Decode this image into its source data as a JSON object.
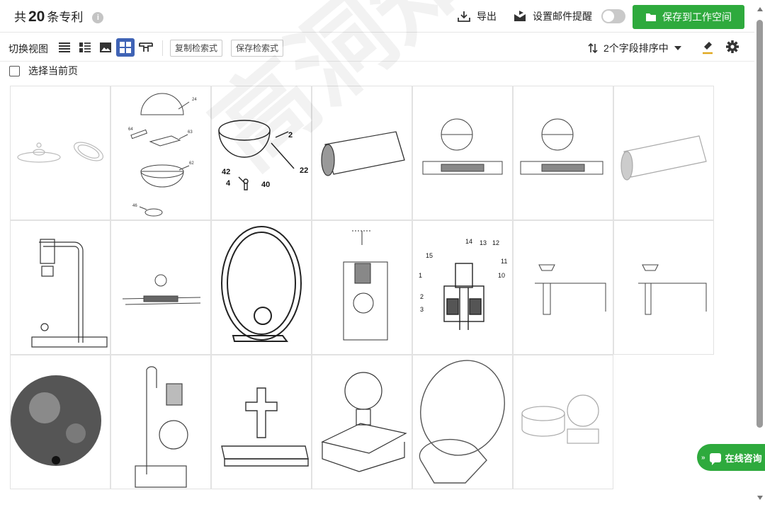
{
  "header": {
    "count_prefix": "共",
    "count": "20",
    "count_suffix": "条专利",
    "info_icon": "i",
    "export_label": "导出",
    "email_alert_label": "设置邮件提醒",
    "email_alert_enabled": false,
    "save_workspace_label": "保存到工作空间",
    "accent_color": "#2eaa3d"
  },
  "toolbar": {
    "view_label": "切换视图",
    "views": [
      "list-view-icon",
      "detail-list-view-icon",
      "image-view-icon",
      "grid-view-icon",
      "pattern-view-icon"
    ],
    "active_view": "grid-view-icon",
    "copy_query_label": "复制检索式",
    "save_query_label": "保存检索式",
    "sort_label": "2个字段排序中"
  },
  "select_page_label": "选择当前页",
  "patents": [
    {
      "figure": "disc-lamp"
    },
    {
      "figure": "exploded-sphere"
    },
    {
      "figure": "bowl-with-pin"
    },
    {
      "figure": "cylinder-texture"
    },
    {
      "figure": "sphere-over-board"
    },
    {
      "figure": "sphere-over-board"
    },
    {
      "figure": "cylinder"
    },
    {
      "figure": "arch-lamp"
    },
    {
      "figure": "small-assembly"
    },
    {
      "figure": "ring-lamp"
    },
    {
      "figure": "bulb-housing"
    },
    {
      "figure": "section-drawing"
    },
    {
      "figure": "frame-drawing"
    },
    {
      "figure": "frame-drawing"
    },
    {
      "figure": "moon-ball"
    },
    {
      "figure": "arm-lamp"
    },
    {
      "figure": "cross-book"
    },
    {
      "figure": "bulb-box"
    },
    {
      "figure": "ring-stand"
    },
    {
      "figure": "speaker-set"
    }
  ],
  "float_consult_label": "在线咨询",
  "watermark_text": "高洞知识产权"
}
